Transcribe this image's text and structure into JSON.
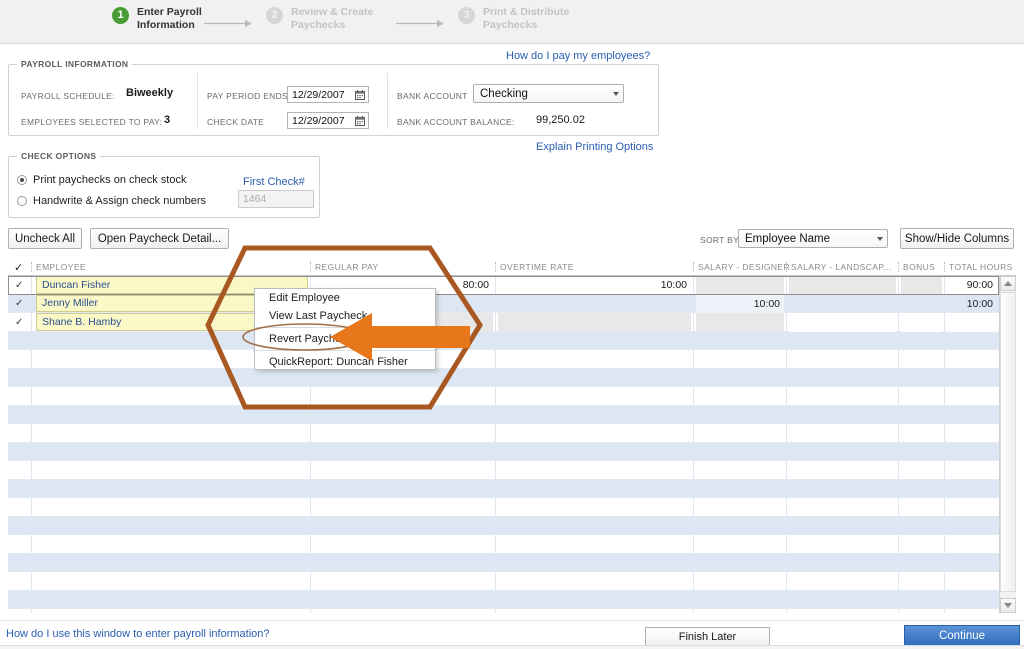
{
  "wizard": {
    "steps": [
      {
        "num": "1",
        "label": "Enter Payroll\nInformation",
        "state": "active"
      },
      {
        "num": "2",
        "label": "Review & Create\nPaychecks",
        "state": "inactive"
      },
      {
        "num": "3",
        "label": "Print & Distribute\nPaychecks",
        "state": "inactive"
      }
    ]
  },
  "links": {
    "pay_employees": "How do I pay my employees?",
    "explain_printing": "Explain Printing Options",
    "window_help": "How do I use this window to enter payroll information?"
  },
  "payroll_information": {
    "title": "PAYROLL INFORMATION",
    "payroll_schedule_label": "PAYROLL SCHEDULE:",
    "payroll_schedule_value": "Biweekly",
    "employees_selected_label": "EMPLOYEES SELECTED TO PAY:",
    "employees_selected_value": "3",
    "pay_period_ends_label": "PAY PERIOD ENDS",
    "pay_period_ends_value": "12/29/2007",
    "check_date_label": "CHECK DATE",
    "check_date_value": "12/29/2007",
    "bank_account_label": "BANK ACCOUNT",
    "bank_account_value": "Checking",
    "bank_account_balance_label": "BANK ACCOUNT BALANCE:",
    "bank_account_balance_value": "99,250.02"
  },
  "check_options": {
    "title": "CHECK OPTIONS",
    "print_option": "Print paychecks on check stock",
    "handwrite_option": "Handwrite & Assign check numbers",
    "selected": "print",
    "first_check_label": "First Check#",
    "first_check_value": "1464"
  },
  "toolbar": {
    "uncheck_all": "Uncheck All",
    "open_paycheck_detail": "Open Paycheck Detail...",
    "sort_by_label": "SORT BY",
    "sort_by_value": "Employee Name",
    "show_hide_columns": "Show/Hide Columns"
  },
  "table": {
    "check_header": "✓",
    "columns": [
      {
        "key": "employee",
        "label": "EMPLOYEE",
        "align": "left"
      },
      {
        "key": "regular_pay",
        "label": "REGULAR PAY",
        "align": "right"
      },
      {
        "key": "overtime_rate",
        "label": "OVERTIME RATE",
        "align": "right"
      },
      {
        "key": "salary_designer",
        "label": "SALARY - DESIGNER",
        "align": "right"
      },
      {
        "key": "salary_landscape",
        "label": "SALARY - LANDSCAP...",
        "align": "right"
      },
      {
        "key": "bonus",
        "label": "BONUS",
        "align": "right"
      },
      {
        "key": "total_hours",
        "label": "TOTAL HOURS",
        "align": "right"
      }
    ],
    "rows": [
      {
        "checked": "✓",
        "employee": "Duncan Fisher",
        "regular_pay": "80:00",
        "overtime_rate": "10:00",
        "salary_designer": "",
        "salary_landscape": "",
        "bonus": "",
        "total_hours": "90:00",
        "selected": true
      },
      {
        "checked": "✓",
        "employee": "Jenny Miller",
        "regular_pay": "",
        "overtime_rate": "",
        "salary_designer": "10:00",
        "salary_landscape": "",
        "bonus": "",
        "total_hours": "10:00",
        "selected": false
      },
      {
        "checked": "✓",
        "employee": "Shane B. Hamby",
        "regular_pay": "",
        "overtime_rate": "",
        "salary_designer": "",
        "salary_landscape": "",
        "bonus": "",
        "total_hours": "",
        "selected": false
      }
    ],
    "empty_row_count": 15
  },
  "context_menu": {
    "items": [
      "Edit Employee",
      "View Last Paycheck",
      "Revert Paycheck",
      "QuickReport: Duncan Fisher"
    ],
    "highlighted": "Revert Paycheck"
  },
  "footer": {
    "finish_later": "Finish Later",
    "continue": "Continue"
  },
  "colors": {
    "accent_blue": "#2a5db0",
    "continue_blue": "#2f6cbd",
    "active_step_green": "#4a9c34",
    "annotation_orange": "#E8761A",
    "annotation_brown": "#A85820",
    "row_stripe": "#dde7f3",
    "selected_row_yellow": "#fbf8c8"
  }
}
